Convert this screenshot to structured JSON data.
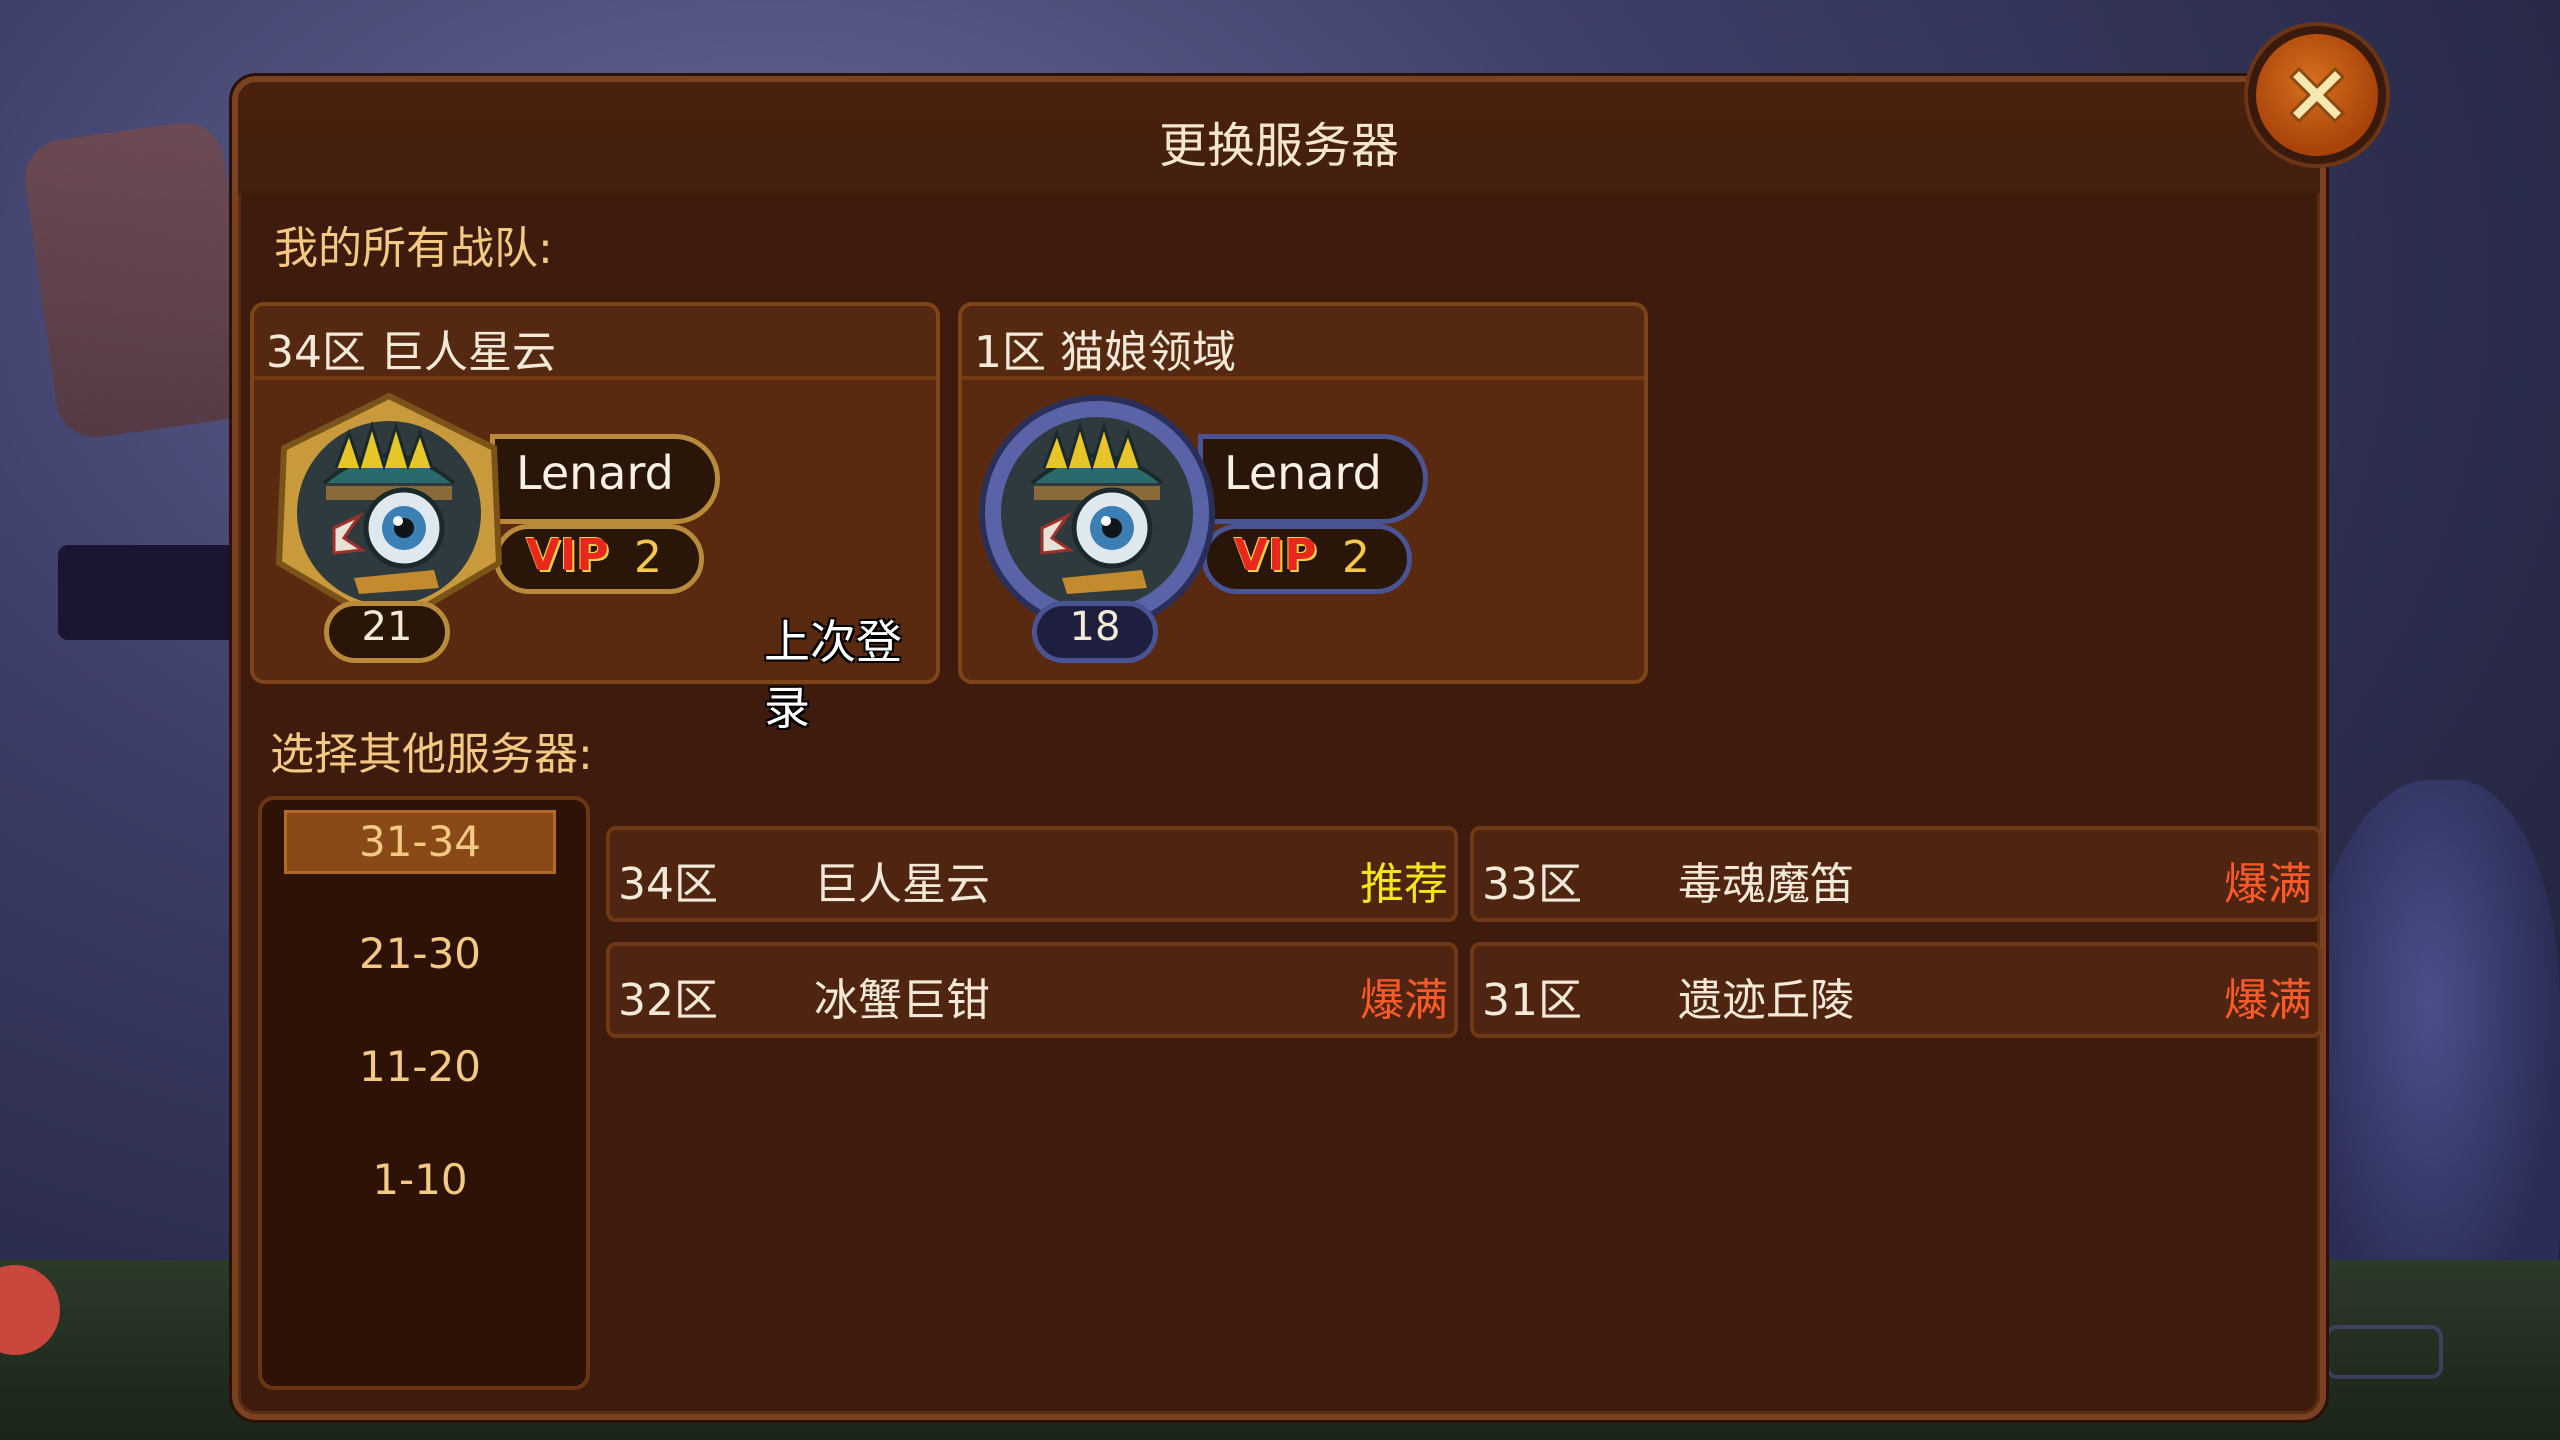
{
  "dialog": {
    "title": "更换服务器"
  },
  "my_teams": {
    "label": "我的所有战队:",
    "teams": [
      {
        "server": "34区 巨人星云",
        "name": "Lenard",
        "vip_label": "VIP",
        "vip_level": "2",
        "level": "21",
        "last_login": "上次登录",
        "frame": "gold"
      },
      {
        "server": "1区 猫娘领域",
        "name": "Lenard",
        "vip_label": "VIP",
        "vip_level": "2",
        "level": "18",
        "frame": "blue"
      }
    ]
  },
  "other_servers": {
    "label": "选择其他服务器:",
    "ranges": [
      "31-34",
      "21-30",
      "11-20",
      "1-10"
    ],
    "selected_range": "31-34",
    "servers": [
      {
        "zone": "34区",
        "name": "巨人星云",
        "status": "推荐",
        "status_color": "#f5e61c"
      },
      {
        "zone": "33区",
        "name": "毒魂魔笛",
        "status": "爆满",
        "status_color": "#ff5a2a"
      },
      {
        "zone": "32区",
        "name": "冰蟹巨钳",
        "status": "爆满",
        "status_color": "#ff5a2a"
      },
      {
        "zone": "31区",
        "name": "遗迹丘陵",
        "status": "爆满",
        "status_color": "#ff5a2a"
      }
    ]
  },
  "colors": {
    "dialog_bg": "#3e1b0c",
    "label_gold": "#f3c983",
    "vip_red": "#e8281c"
  },
  "icons": {
    "close": "close-x-icon",
    "avatar": "fish-warrior-avatar-icon"
  }
}
